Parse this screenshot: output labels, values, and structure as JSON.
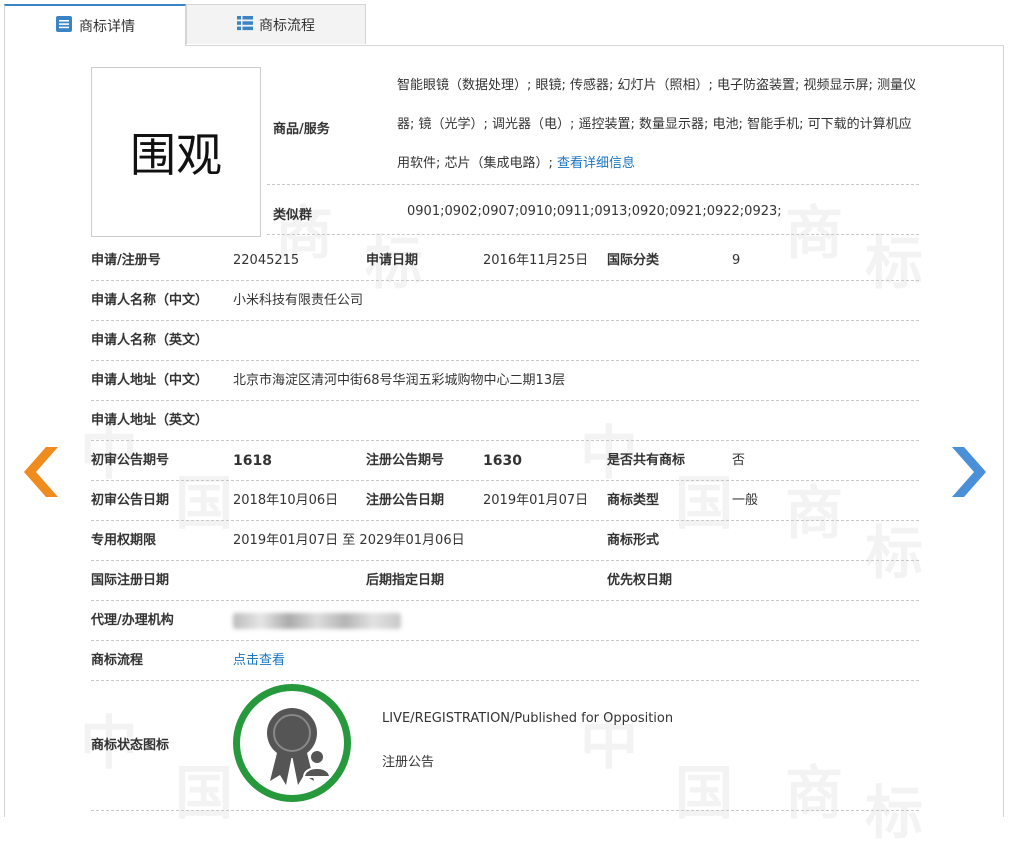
{
  "tabs": [
    {
      "label": "商标详情",
      "icon": "list-icon",
      "active": true
    },
    {
      "label": "商标流程",
      "icon": "grid-icon",
      "active": false
    }
  ],
  "logo_text": "围观",
  "goods_services": {
    "label": "商品/服务",
    "text": "智能眼镜（数据处理）; 眼镜; 传感器; 幻灯片（照相）; 电子防盗装置; 视频显示屏; 测量仪器; 镜（光学）; 调光器（电）; 遥控装置; 数量显示器; 电池; 智能手机; 可下载的计算机应用软件; 芯片（集成电路）;",
    "link": "查看详细信息"
  },
  "similar_group": {
    "label": "类似群",
    "value": "0901;0902;0907;0910;0911;0913;0920;0921;0922;0923;"
  },
  "fields": {
    "reg_no": {
      "label": "申请/注册号",
      "value": "22045215"
    },
    "app_date": {
      "label": "申请日期",
      "value": "2016年11月25日"
    },
    "intl_class": {
      "label": "国际分类",
      "value": "9"
    },
    "applicant_cn": {
      "label": "申请人名称（中文）",
      "value": "小米科技有限责任公司"
    },
    "applicant_en": {
      "label": "申请人名称（英文）",
      "value": ""
    },
    "address_cn": {
      "label": "申请人地址（中文）",
      "value": "北京市海淀区清河中街68号华润五彩城购物中心二期13层"
    },
    "address_en": {
      "label": "申请人地址（英文）",
      "value": ""
    },
    "prelim_pub_no": {
      "label": "初审公告期号",
      "value": "1618"
    },
    "reg_pub_no": {
      "label": "注册公告期号",
      "value": "1630"
    },
    "shared": {
      "label": "是否共有商标",
      "value": "否"
    },
    "prelim_pub_date": {
      "label": "初审公告日期",
      "value": "2018年10月06日"
    },
    "reg_pub_date": {
      "label": "注册公告日期",
      "value": "2019年01月07日"
    },
    "tm_type": {
      "label": "商标类型",
      "value": "一般"
    },
    "exclusive_period": {
      "label": "专用权期限",
      "value": "2019年01月07日 至 2029年01月06日"
    },
    "tm_form": {
      "label": "商标形式",
      "value": ""
    },
    "intl_reg_date": {
      "label": "国际注册日期",
      "value": ""
    },
    "later_designation": {
      "label": "后期指定日期",
      "value": ""
    },
    "priority_date": {
      "label": "优先权日期",
      "value": ""
    },
    "agent": {
      "label": "代理/办理机构",
      "value": ""
    },
    "process": {
      "label": "商标流程",
      "link": "点击查看"
    }
  },
  "status": {
    "label": "商标状态图标",
    "line1": "LIVE/REGISTRATION/Published for Opposition",
    "line2": "注册公告",
    "icon": "registration-badge-icon"
  },
  "colors": {
    "accent": "#3a83c5",
    "link": "#1a76c2",
    "prev_arrow": "#f08c1e",
    "next_arrow": "#4a90d9",
    "status_ring": "#26993c"
  }
}
